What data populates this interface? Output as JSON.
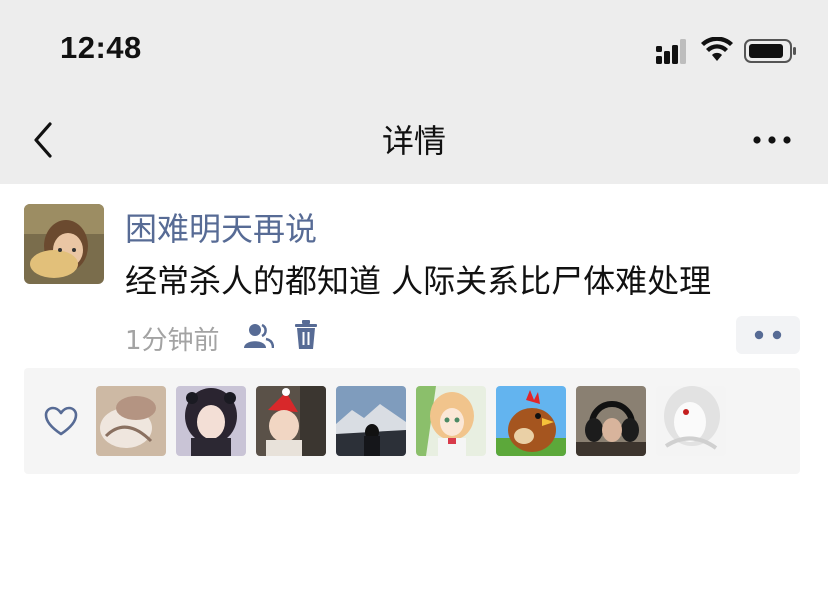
{
  "status_bar": {
    "time": "12:48"
  },
  "nav": {
    "title": "详情"
  },
  "post": {
    "username": "困难明天再说",
    "text": "经常杀人的都知道 人际关系比尸体难处理",
    "time": "1分钟前"
  },
  "colors": {
    "link": "#576b95",
    "nav_bg": "#ededed",
    "muted": "#a3a3a3",
    "panel_bg": "#f5f5f5"
  }
}
